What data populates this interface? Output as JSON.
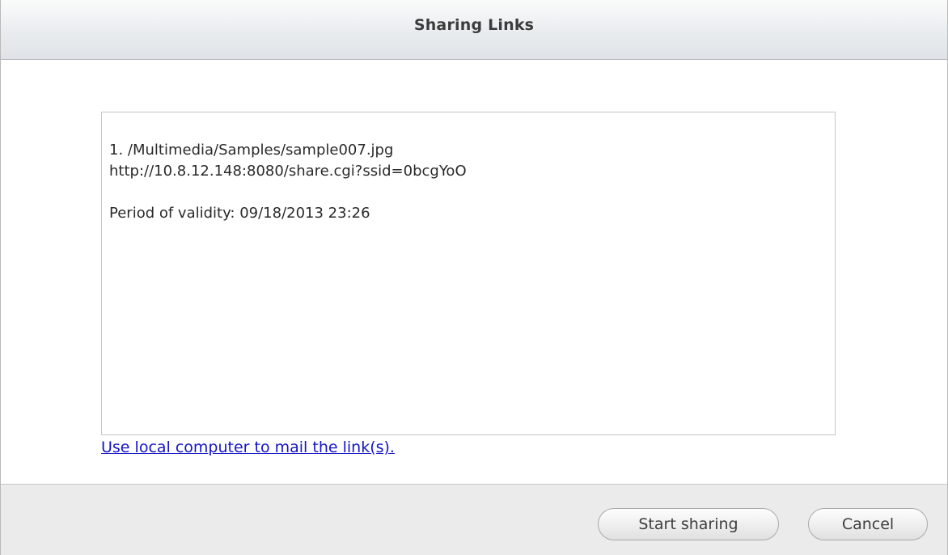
{
  "dialog": {
    "title": "Sharing Links"
  },
  "links_box": {
    "lines": [
      "1. /Multimedia/Samples/sample007.jpg",
      "http://10.8.12.148:8080/share.cgi?ssid=0bcgYoO",
      "",
      "Period of validity: 09/18/2013 23:26"
    ]
  },
  "mail_link": "Use local computer to mail the link(s).",
  "buttons": {
    "start_sharing": "Start sharing",
    "cancel": "Cancel"
  }
}
